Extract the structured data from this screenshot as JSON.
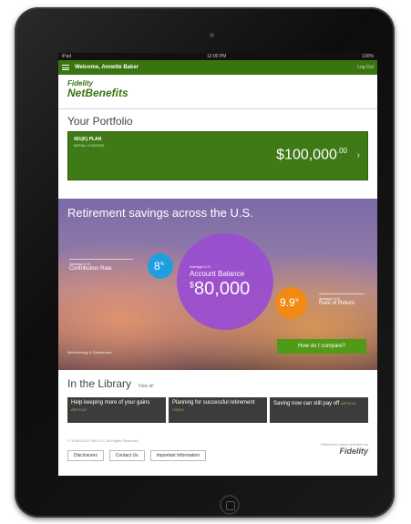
{
  "statusbar": {
    "left": "iPad",
    "center": "12:00 PM",
    "right": "100%"
  },
  "topbar": {
    "welcome": "Welcome, Annette Baker",
    "logout": "Log Out"
  },
  "brand": {
    "line1": "Fidelity",
    "line2": "NetBenefits"
  },
  "portfolio": {
    "title": "Your Portfolio",
    "plan_name": "401(K) PLAN",
    "plan_sub": "DETAIL CONTENT",
    "amount": "$100,000",
    "amount_cents": ".00",
    "chevron": "›"
  },
  "hero": {
    "title": "Retirement savings across the U.S.",
    "contribution": {
      "small": "Average U.S.",
      "label": "Contribution Rate",
      "value": "8",
      "unit": "%"
    },
    "balance": {
      "small": "Average U.S.",
      "label": "Account Balance",
      "value": "80,000",
      "currency": "$"
    },
    "rate": {
      "small": "Average U.S.",
      "label": "Rate of Return",
      "value": "9.9",
      "unit": "%"
    },
    "footnote": "Methodology & Disclosures",
    "compare_button": "How do I compare?"
  },
  "library": {
    "title": "In the Library",
    "view_all": "View all",
    "cards": [
      {
        "text": "Help keeping more of your gains",
        "tag": "ARTICLE"
      },
      {
        "text": "Planning for successful retirement",
        "tag": "VIDEO"
      },
      {
        "text": "Saving now can still pay off",
        "tag": "ARTICLE"
      }
    ]
  },
  "footer": {
    "copyright": "© 1998-2014 FMR LLC All Rights Reserved.",
    "buttons": [
      "Disclosures",
      "Contact Us",
      "Important Information"
    ],
    "provided_by": "Retirement plans provided by",
    "logo": "Fidelity"
  },
  "colors": {
    "brand_green": "#3a7410",
    "contribution_blue": "#1e9fe0",
    "balance_purple": "#9b4fd0",
    "rate_orange": "#f08a12"
  },
  "icons": {
    "menu": "hamburger-menu-icon",
    "plan_chevron": "chevron-right-icon",
    "home": "home-button"
  }
}
